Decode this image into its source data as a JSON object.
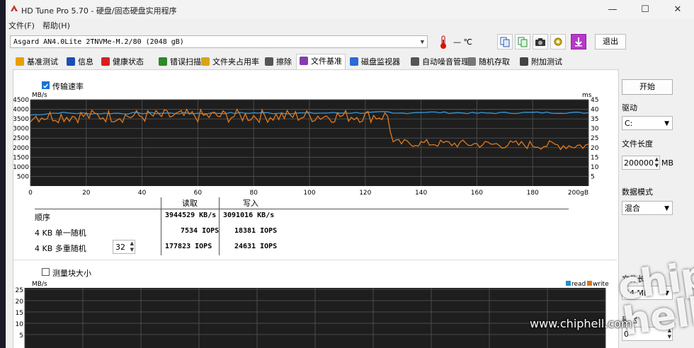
{
  "window": {
    "title": "HD Tune Pro 5.70 - 硬盘/固态硬盘实用程序",
    "min": "—",
    "max": "☐",
    "close": "✕"
  },
  "menu": [
    "文件(F)",
    "帮助(H)"
  ],
  "drive": {
    "selected": "Asgard AN4.0Lite 2TNVMe-M.2/80 (2048 gB)",
    "temperature": "— ℃",
    "exit_label": "退出"
  },
  "tabs": [
    {
      "label": "基准测试",
      "icon": "benchmark-icon",
      "color": "#e8a000"
    },
    {
      "label": "信息",
      "icon": "info-icon",
      "color": "#1a4fb4"
    },
    {
      "label": "健康状态",
      "icon": "health-icon",
      "color": "#d62020"
    },
    {
      "label": "错误扫描",
      "icon": "scan-icon",
      "color": "#2a8a2a"
    },
    {
      "label": "文件夹占用率",
      "icon": "folder-icon",
      "color": "#d8a418"
    },
    {
      "label": "擦除",
      "icon": "erase-icon",
      "color": "#555555"
    },
    {
      "label": "文件基准",
      "icon": "file-benchmark-icon",
      "color": "#8a3ab0"
    },
    {
      "label": "磁盘监视器",
      "icon": "monitor-icon",
      "color": "#2a6ad8"
    },
    {
      "label": "自动噪音管理",
      "icon": "noise-icon",
      "color": "#555555"
    },
    {
      "label": "随机存取",
      "icon": "random-access-icon",
      "color": "#777777"
    },
    {
      "label": "附加测试",
      "icon": "extra-tests-icon",
      "color": "#444444"
    }
  ],
  "transfer": {
    "checkbox_label": "传输速率",
    "checked": true
  },
  "chart_data": {
    "type": "line",
    "ylabel_left": "MB/s",
    "ylabel_right": "ms",
    "x_ticks": [
      "0",
      "20",
      "40",
      "60",
      "80",
      "100",
      "120",
      "140",
      "160",
      "180",
      "200gB"
    ],
    "y_left_ticks": [
      "4500",
      "4000",
      "3500",
      "3000",
      "2500",
      "2000",
      "1500",
      "1000",
      "500"
    ],
    "y_right_ticks": [
      "45",
      "40",
      "35",
      "30",
      "25",
      "20",
      "15",
      "10",
      "5"
    ],
    "xlim": [
      0,
      200
    ],
    "ylim_left": [
      0,
      4500
    ],
    "series": [
      {
        "color": "#3a9ad8",
        "x": [
          0,
          10,
          20,
          40,
          60,
          80,
          100,
          120,
          128,
          130,
          140,
          160,
          180,
          200
        ],
        "values": [
          3700,
          3820,
          3780,
          3800,
          3790,
          3810,
          3800,
          3820,
          3850,
          3780,
          3850,
          3800,
          3830,
          3820
        ]
      },
      {
        "color": "#e07a20",
        "x": [
          0,
          128,
          130,
          200
        ],
        "values": [
          3650,
          3650,
          2250,
          2100
        ],
        "jitter": [
          350,
          350,
          200,
          250
        ]
      }
    ]
  },
  "results": {
    "col_read": "读取",
    "col_write": "写入",
    "rows": [
      {
        "label": "顺序",
        "read": "3944529 KB/s",
        "write": "3091016 KB/s"
      },
      {
        "label": "4 KB 单一随机",
        "read": "7534 IOPS",
        "write": "18381 IOPS"
      },
      {
        "label": "4 KB 多重随机",
        "read": "177823 IOPS",
        "write": "24631 IOPS",
        "queue": "32"
      }
    ]
  },
  "blocksize": {
    "checkbox_label": "测量块大小",
    "checked": false,
    "legend_read": "read",
    "legend_write": "write",
    "read_color": "#1f8fd0",
    "write_color": "#d8781a",
    "ylabel": "MB/s",
    "y_ticks": [
      "25",
      "20",
      "15",
      "10",
      "5"
    ]
  },
  "right_panel": {
    "start_label": "开始",
    "drive_label": "驱动",
    "drive_value": "C:",
    "file_length_label": "文件长度",
    "file_length_value": "200000",
    "file_length_unit": "MB",
    "data_mode_label": "数据模式",
    "data_mode_value": "混合",
    "file_size_label": "文件长",
    "file_size_value": "64 MB",
    "delay_label": "延迟",
    "delay_value": "0"
  },
  "watermark": {
    "site": "www.chiphell.com",
    "logo": "chip hell"
  }
}
